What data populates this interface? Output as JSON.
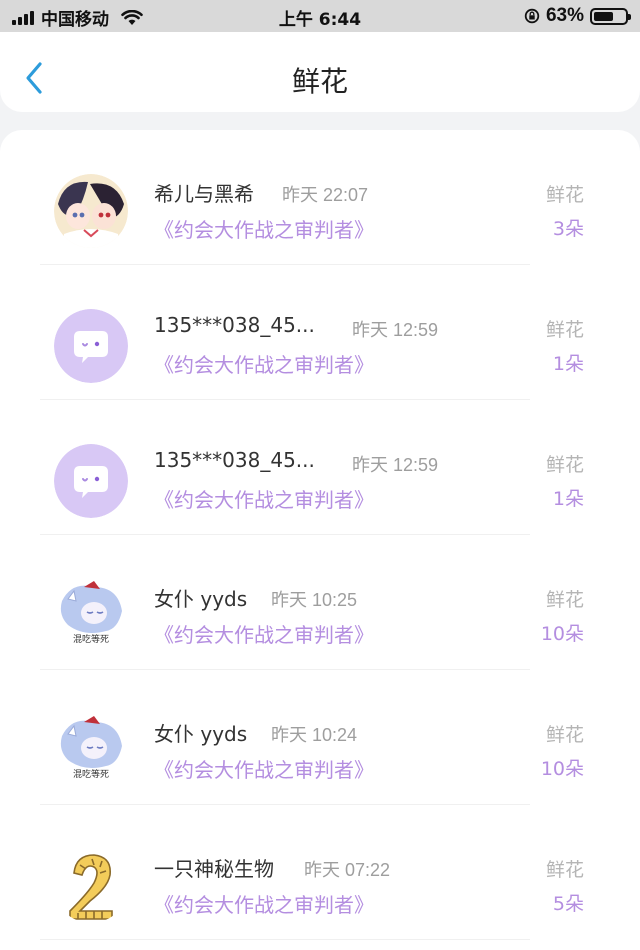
{
  "status_bar": {
    "carrier": "中国移动",
    "time": "上午 6:44",
    "battery": "63%",
    "battery_level": 0.63
  },
  "header": {
    "title": "鲜花",
    "back_icon": "chevron-left-icon",
    "accent": "#2d9cdb"
  },
  "colors": {
    "purple": "#b48ee0",
    "default_avatar_bg": "#d8c8f5"
  },
  "records": [
    {
      "user": "希儿与黑希",
      "time": "昨天 22:07",
      "book": "《约会大作战之审判者》",
      "gift": "鲜花",
      "count": "3朵",
      "avatar": "anime-avatar"
    },
    {
      "user": "135***038_45...",
      "time": "昨天 12:59",
      "book": "《约会大作战之审判者》",
      "gift": "鲜花",
      "count": "1朵",
      "avatar": "default-chat-avatar"
    },
    {
      "user": "135***038_45...",
      "time": "昨天 12:59",
      "book": "《约会大作战之审判者》",
      "gift": "鲜花",
      "count": "1朵",
      "avatar": "default-chat-avatar"
    },
    {
      "user": "女仆 yyds",
      "time": "昨天 10:25",
      "book": "《约会大作战之审判者》",
      "gift": "鲜花",
      "count": "10朵",
      "avatar": "maid-avatar",
      "avatar_caption": "混吃等死"
    },
    {
      "user": "女仆 yyds",
      "time": "昨天 10:24",
      "book": "《约会大作战之审判者》",
      "gift": "鲜花",
      "count": "10朵",
      "avatar": "maid-avatar",
      "avatar_caption": "混吃等死"
    },
    {
      "user": "一只神秘生物",
      "time": "昨天 07:22",
      "book": "《约会大作战之审判者》",
      "gift": "鲜花",
      "count": "5朵",
      "avatar": "number-two-avatar"
    }
  ]
}
